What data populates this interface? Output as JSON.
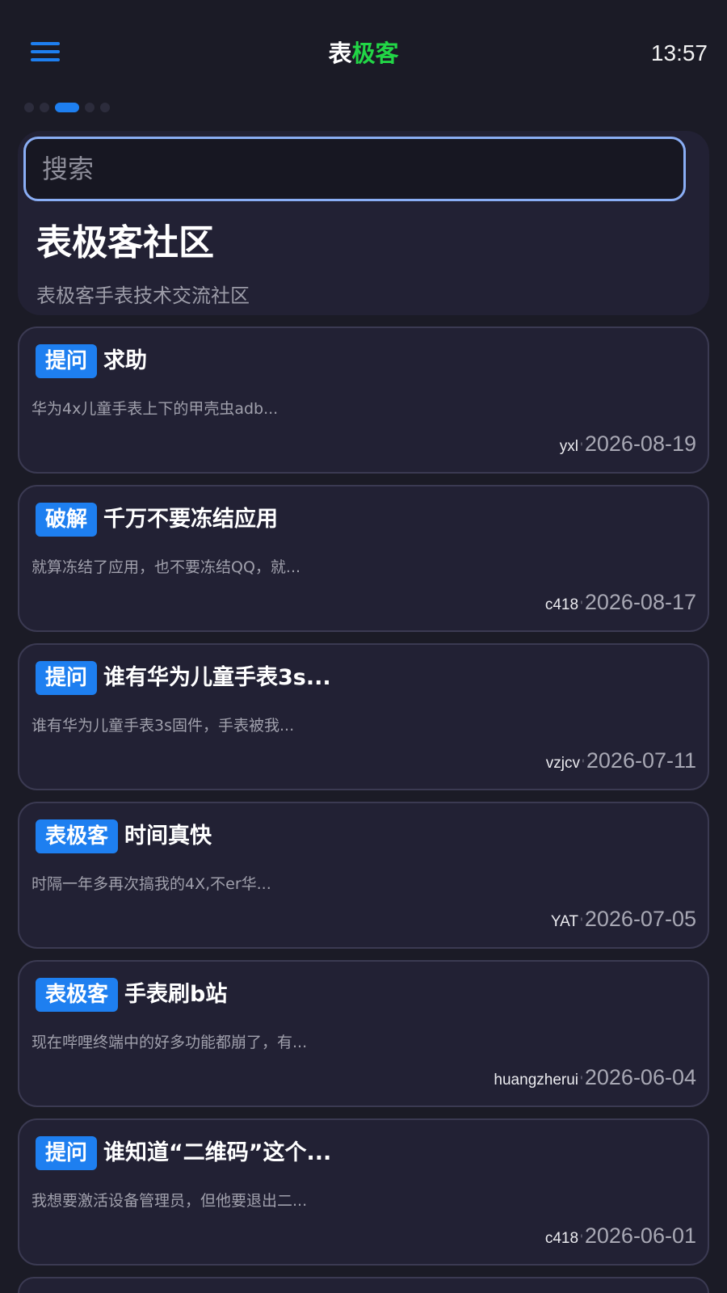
{
  "header": {
    "title_part1": "表",
    "title_part2": "极客",
    "time": "13:57",
    "accent_color": "#1e7ff0",
    "title_highlight_color": "#22d646"
  },
  "carousel": {
    "total": 5,
    "active_index": 2
  },
  "hero": {
    "search_placeholder": "搜索",
    "title": "表极客社区",
    "subtitle": "表极客手表技术交流社区"
  },
  "posts": [
    {
      "tag": "提问",
      "title": "求助",
      "excerpt": "华为4x儿童手表上下的甲壳虫adb...",
      "author": "yxl",
      "date": "2026-08-19"
    },
    {
      "tag": "破解",
      "title": "千万不要冻结应用",
      "excerpt": "就算冻结了应用，也不要冻结QQ，就...",
      "author": "c418",
      "date": "2026-08-17"
    },
    {
      "tag": "提问",
      "title": "谁有华为儿童手表3s...",
      "excerpt": "谁有华为儿童手表3s固件，手表被我...",
      "author": "vzjcv",
      "date": "2026-07-11"
    },
    {
      "tag": "表极客",
      "title": "时间真快",
      "excerpt": "时隔一年多再次搞我的4X,不er华...",
      "author": "YAT",
      "date": "2026-07-05"
    },
    {
      "tag": "表极客",
      "title": "手表刷b站",
      "excerpt": "现在哔哩终端中的好多功能都崩了，有...",
      "author": "huangzherui",
      "date": "2026-06-04"
    },
    {
      "tag": "提问",
      "title": "谁知道“二维码”这个...",
      "excerpt": "我想要激活设备管理员，但他要退出二...",
      "author": "c418",
      "date": "2026-06-01"
    }
  ]
}
